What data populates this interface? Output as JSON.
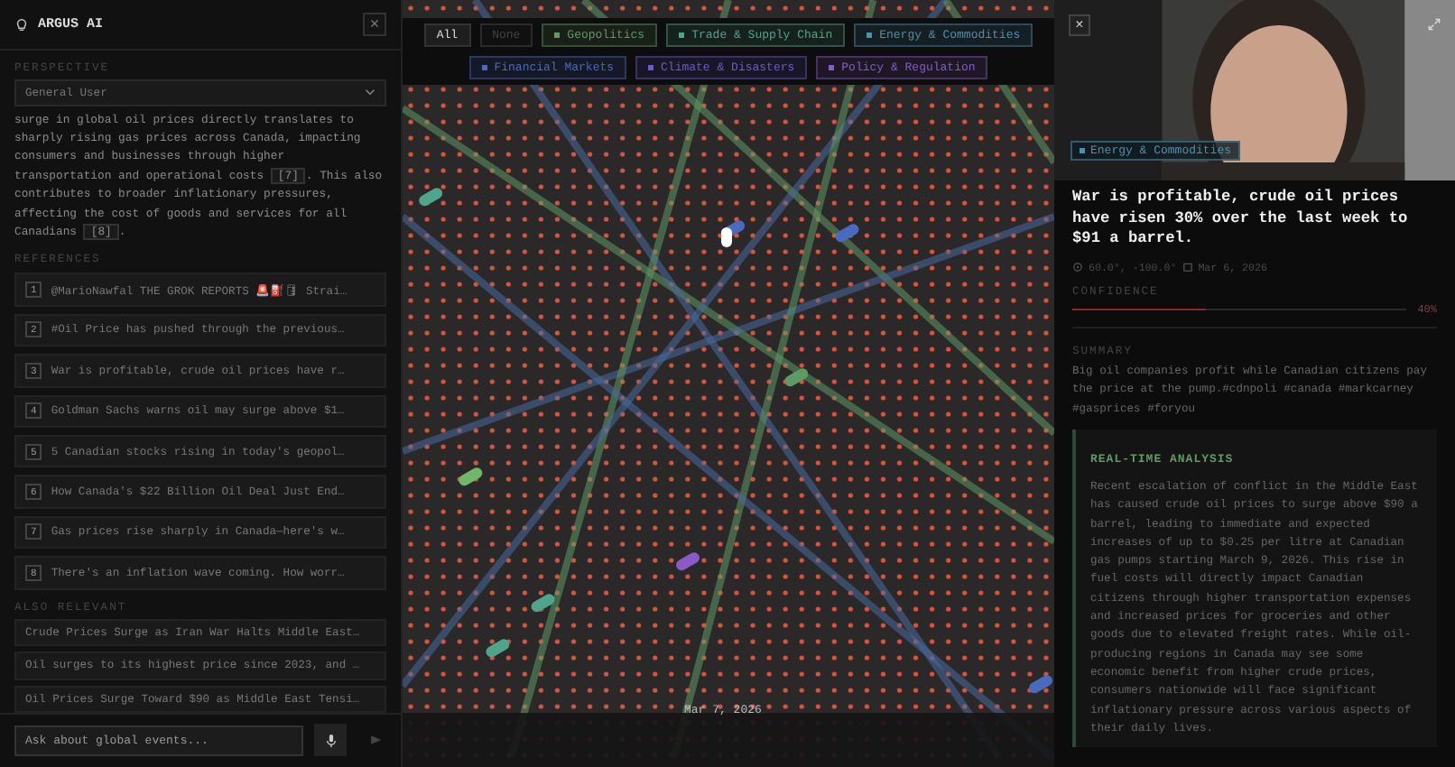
{
  "assistant": {
    "title": "ARGUS AI",
    "close": "×",
    "perspective_label": "PERSPECTIVE",
    "perspective": "General User",
    "answer": [
      {
        "text": "surge in global oil prices directly translates to sharply rising gas prices across Canada, impacting consumers and businesses through higher transportation and operational costs ",
        "cite": "[7]",
        "after": ". This also contributes to broader inflationary pressures, affecting the cost of goods and services for all Canadians ",
        "cite2": "[8]",
        "end": "."
      }
    ],
    "references_label": "REFERENCES",
    "references": [
      {
        "n": "1",
        "text": "@MarioNawfal THE GROK REPORTS 🚨⛽🛢 Strai…"
      },
      {
        "n": "2",
        "text": "#Oil Price has pushed through the previous…"
      },
      {
        "n": "3",
        "text": "War is profitable, crude oil prices have r…"
      },
      {
        "n": "4",
        "text": "Goldman Sachs warns oil may surge above $1…"
      },
      {
        "n": "5",
        "text": "5 Canadian stocks rising in today's geopol…"
      },
      {
        "n": "6",
        "text": "How Canada's $22 Billion Oil Deal Just End…"
      },
      {
        "n": "7",
        "text": "Gas prices rise sharply in Canada—here's w…"
      },
      {
        "n": "8",
        "text": "There's an inflation wave coming. How worr…"
      }
    ],
    "also_label": "ALSO RELEVANT",
    "also": [
      "Crude Prices Surge as Iran War Halts Middle East…",
      "Oil surges to its highest price since 2023, and …",
      "Oil Prices Surge Toward $90 as Middle East Tensi…"
    ],
    "input": {
      "placeholder": "Ask about global events..."
    }
  },
  "filters": [
    {
      "label": "All",
      "kind": "plain",
      "selected": true
    },
    {
      "label": "None",
      "kind": "plain",
      "selected": false
    },
    {
      "label": "Geopolitics",
      "kind": "category",
      "selected": true,
      "color": "#5f9a64"
    },
    {
      "label": "Trade & Supply Chain",
      "kind": "category",
      "selected": true,
      "color": "#4fa58c"
    },
    {
      "label": "Energy & Commodities",
      "kind": "category",
      "selected": true,
      "color": "#4a90b0"
    },
    {
      "label": "Financial Markets",
      "kind": "category",
      "selected": true,
      "color": "#4a6ac0"
    },
    {
      "label": "Climate & Disasters",
      "kind": "category",
      "selected": true,
      "color": "#6a5ad0"
    },
    {
      "label": "Policy & Regulation",
      "kind": "category",
      "selected": true,
      "color": "#8a5ac8"
    }
  ],
  "map": {
    "date": "Mar 7, 2026"
  },
  "detail": {
    "close": "×",
    "category": {
      "label": "Energy & Commodities",
      "color": "#4a90b0"
    },
    "title": "War is profitable, crude oil prices have risen 30% over the last week to $91 a barrel.",
    "coords": "60.0°, -100.0°",
    "date": "Mar 6, 2026",
    "confidence_label": "CONFIDENCE",
    "confidence": {
      "level": 0.4,
      "reading": "40%"
    },
    "summary_label": "SUMMARY",
    "summary": "Big oil companies profit while Canadian citizens pay the price at the pump.#cdnpoli #canada #markcarney #gasprices #foryou",
    "analysis_label": "REAL-TIME ANALYSIS",
    "analysis": "Recent escalation of conflict in the Middle East has caused crude oil prices to surge above $90 a barrel, leading to immediate and expected increases of up to $0.25 per litre at Canadian gas pumps starting March 9, 2026. This rise in fuel costs will directly impact Canadian citizens through higher transportation expenses and increased prices for groceries and other goods due to elevated freight rates. While oil-producing regions in Canada may see some economic benefit from higher crude prices, consumers nationwide will face significant inflationary pressure across various aspects of their daily lives."
  }
}
